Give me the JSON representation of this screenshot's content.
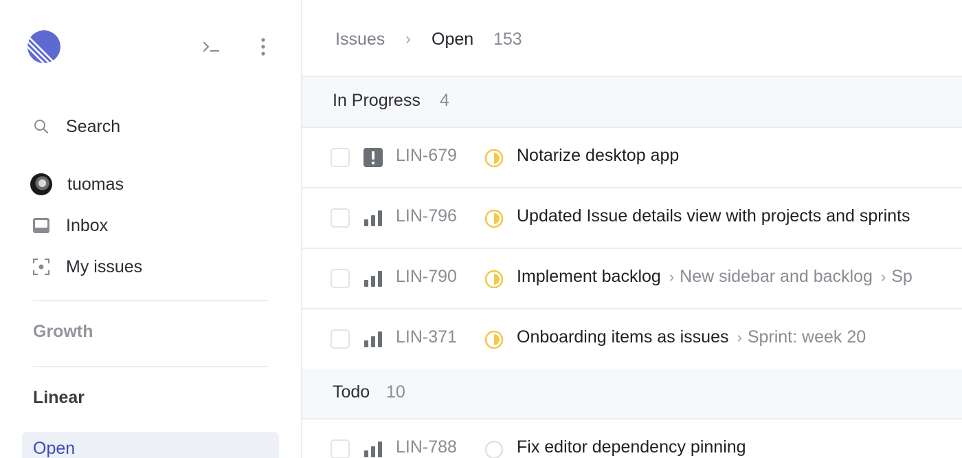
{
  "sidebar": {
    "search_label": "Search",
    "user_name": "tuomas",
    "inbox_label": "Inbox",
    "my_issues_label": "My issues",
    "team_growth": "Growth",
    "team_linear": "Linear",
    "active_view": "Open"
  },
  "header": {
    "crumb_root": "Issues",
    "crumb_separator": "›",
    "crumb_current": "Open",
    "issue_count": "153"
  },
  "groups": [
    {
      "title": "In Progress",
      "count": "4",
      "issues": [
        {
          "id": "LIN-679",
          "priority": "urgent",
          "status": "in-progress",
          "title": "Notarize desktop app",
          "context": []
        },
        {
          "id": "LIN-796",
          "priority": "high",
          "status": "in-progress",
          "title": "Updated Issue details view with projects and sprints",
          "context": []
        },
        {
          "id": "LIN-790",
          "priority": "high",
          "status": "in-progress",
          "title": "Implement backlog",
          "context": [
            "New sidebar and backlog",
            "Sp"
          ]
        },
        {
          "id": "LIN-371",
          "priority": "high",
          "status": "in-progress",
          "title": "Onboarding items as issues",
          "context": [
            "Sprint: week 20"
          ]
        }
      ]
    },
    {
      "title": "Todo",
      "count": "10",
      "issues": [
        {
          "id": "LIN-788",
          "priority": "high",
          "status": "todo",
          "title": "Fix editor dependency pinning",
          "context": []
        }
      ]
    }
  ],
  "colors": {
    "brand": "#5e6ad2",
    "status_in_progress": "#f2c94c",
    "status_todo": "#e2e2e5",
    "priority_icon": "#6b6f76",
    "active_view_bg": "#eef0f8",
    "active_view_text": "#3d4ab8"
  },
  "icons": [
    "linear-logo-icon",
    "terminal-icon",
    "more-vertical-icon",
    "search-icon",
    "inbox-icon",
    "my-issues-icon",
    "urgent-priority-icon",
    "high-priority-icon",
    "in-progress-status-icon",
    "todo-status-icon"
  ]
}
